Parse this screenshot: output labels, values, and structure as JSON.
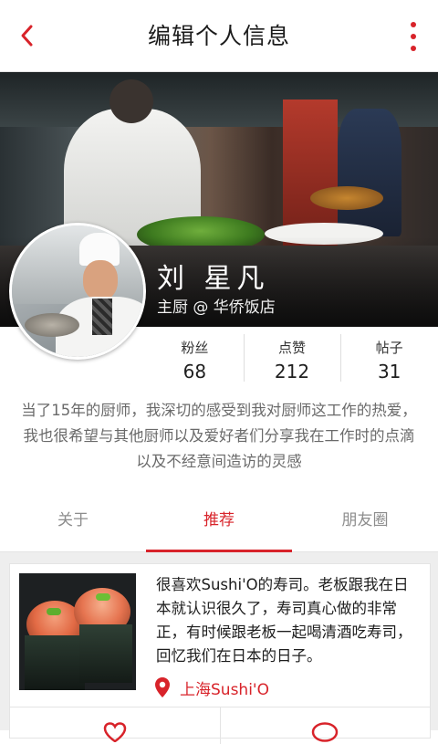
{
  "header": {
    "title": "编辑个人信息",
    "back_icon": "chevron-left-icon",
    "more_icon": "more-vertical-icon",
    "accent_color": "#d8232a"
  },
  "profile": {
    "name": "刘 星凡",
    "role": "主厨 @ 华侨饭店",
    "stats": [
      {
        "label": "粉丝",
        "value": "68"
      },
      {
        "label": "点赞",
        "value": "212"
      },
      {
        "label": "帖子",
        "value": "31"
      }
    ],
    "bio": "当了15年的厨师，我深切的感受到我对厨师这工作的热爱，我也很希望与其他厨师以及爱好者们分享我在工作时的点滴以及不经意间造访的灵感"
  },
  "tabs": [
    {
      "label": "关于",
      "active": false
    },
    {
      "label": "推荐",
      "active": true
    },
    {
      "label": "朋友圈",
      "active": false
    }
  ],
  "post": {
    "text": "很喜欢Sushi'O的寿司。老板跟我在日本就认识很久了，寿司真心做的非常正，有时候跟老板一起喝清酒吃寿司，回忆我们在日本的日子。",
    "location": "上海Sushi'O",
    "location_icon": "map-pin-icon",
    "like_icon": "heart-icon",
    "comment_icon": "comment-icon"
  }
}
